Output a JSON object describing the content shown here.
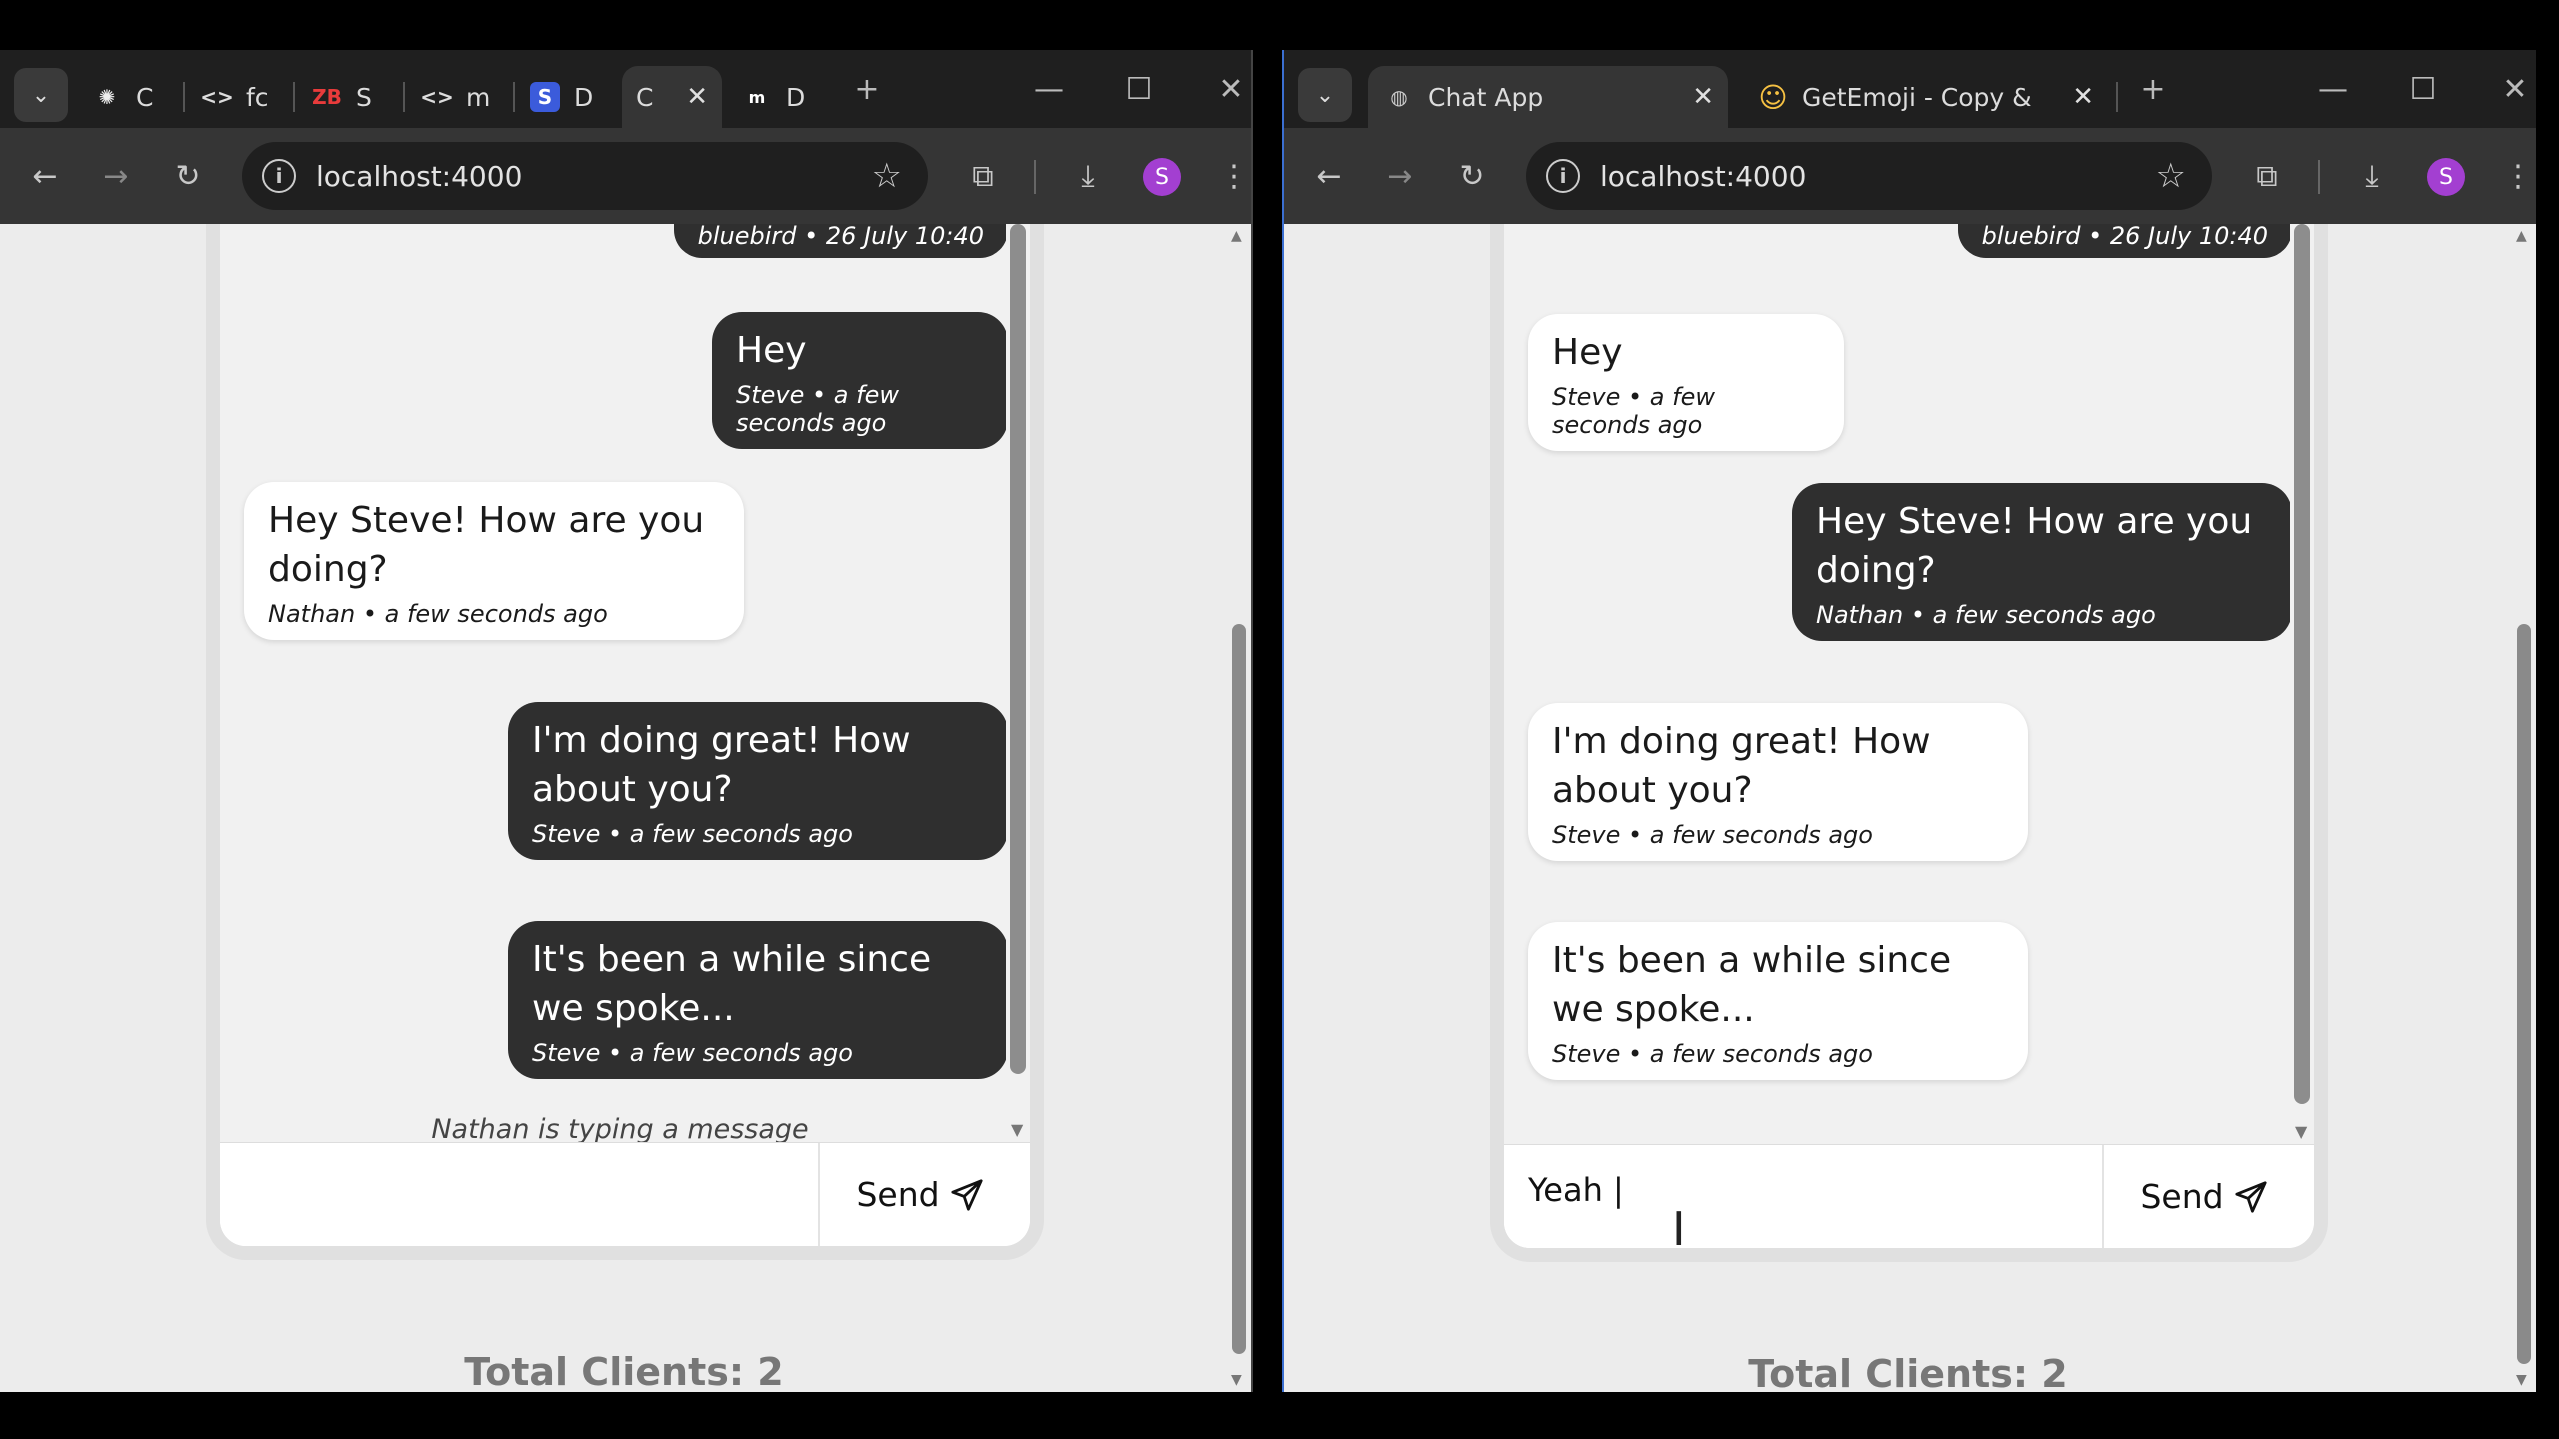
{
  "left_browser": {
    "tabs": [
      {
        "title": "C",
        "icon": "openai-icon"
      },
      {
        "title": "fc",
        "icon": "code-icon"
      },
      {
        "title": "S",
        "icon": "zb-icon"
      },
      {
        "title": "m",
        "icon": "code-icon"
      },
      {
        "title": "D",
        "icon": "s-icon"
      },
      {
        "title": "C",
        "icon": "chat-icon",
        "active": true
      },
      {
        "title": "D",
        "icon": "m-icon"
      }
    ],
    "url": "localhost:4000",
    "profile_initial": "S",
    "chat": {
      "top_meta": "bluebird • 26 July 10:40",
      "messages": [
        {
          "text": "Hey",
          "meta": "Steve • a few seconds ago",
          "style": "dark"
        },
        {
          "text": "Hey Steve! How are you doing?",
          "meta": "Nathan • a few seconds ago",
          "style": "light"
        },
        {
          "text": "I'm doing great! How about you?",
          "meta": "Steve • a few seconds ago",
          "style": "dark"
        },
        {
          "text": "It's been a while since we spoke...",
          "meta": "Steve • a few seconds ago",
          "style": "dark"
        }
      ],
      "typing": "Nathan is typing a message",
      "input_value": "",
      "send_label": "Send"
    },
    "total_clients": "Total Clients: 2"
  },
  "right_browser": {
    "tabs": [
      {
        "title": "Chat App",
        "icon": "globe-icon",
        "active": true
      },
      {
        "title": "GetEmoji - Copy & Pas",
        "icon": "emoji-icon"
      }
    ],
    "url": "localhost:4000",
    "profile_initial": "S",
    "chat": {
      "top_meta": "bluebird • 26 July 10:40",
      "messages": [
        {
          "text": "Hey",
          "meta": "Steve • a few seconds ago",
          "style": "light"
        },
        {
          "text": "Hey Steve! How are you doing?",
          "meta": "Nathan • a few seconds ago",
          "style": "dark"
        },
        {
          "text": "I'm doing great! How about you?",
          "meta": "Steve • a few seconds ago",
          "style": "light"
        },
        {
          "text": "It's been a while since we spoke...",
          "meta": "Steve • a few seconds ago",
          "style": "light"
        }
      ],
      "input_value": "Yeah |",
      "send_label": "Send"
    },
    "total_clients": "Total Clients: 2"
  },
  "colors": {
    "accent": "#a33fd1",
    "bubble_dark": "#2f2f2f",
    "page_bg": "#ececec"
  }
}
